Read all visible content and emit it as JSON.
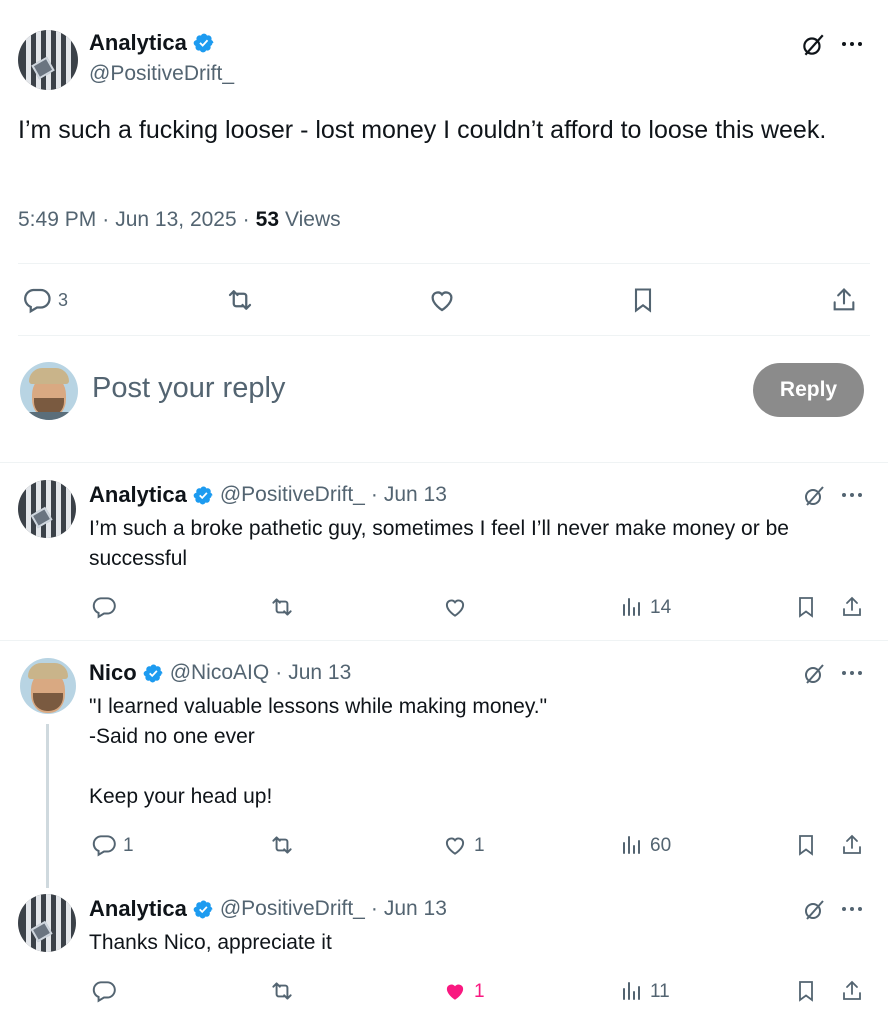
{
  "main_post": {
    "author_name": "Analytica",
    "author_handle": "@PositiveDrift_",
    "text": "I’m such a fucking looser - lost money I couldn’t afford to loose this week.",
    "time": "5:49 PM",
    "date": "Jun 13, 2025",
    "views_count": "53",
    "views_label": "Views",
    "reply_count": "3"
  },
  "composer": {
    "placeholder": "Post your reply",
    "reply_button": "Reply"
  },
  "replies": [
    {
      "author_name": "Analytica",
      "author_handle": "@PositiveDrift_",
      "date": "Jun 13",
      "text": "I’m such a broke pathetic guy, sometimes I feel I’ll never make money or be successful",
      "reply_count": "",
      "like_count": "",
      "views": "14"
    },
    {
      "author_name": "Nico",
      "author_handle": "@NicoAIQ",
      "date": "Jun 13",
      "text_lines": [
        "\"I learned valuable lessons while making money.\"",
        "-Said no one ever",
        "",
        "Keep your head up!"
      ],
      "reply_count": "1",
      "like_count": "1",
      "views": "60"
    },
    {
      "author_name": "Analytica",
      "author_handle": "@PositiveDrift_",
      "date": "Jun 13",
      "text": "Thanks Nico, appreciate it",
      "reply_count": "",
      "like_count": "1",
      "liked": true,
      "views": "11"
    }
  ],
  "separator": "·",
  "colors": {
    "verified": "#1d9bf0",
    "muted": "#536471",
    "like_active": "#f91880",
    "reply_button_bg": "#8b8b8b",
    "thread_line": "#cfd9de"
  },
  "icons": [
    "verified-badge-icon",
    "grok-icon",
    "more-icon",
    "reply-icon",
    "repost-icon",
    "like-icon",
    "bookmark-icon",
    "share-icon",
    "views-icon"
  ]
}
